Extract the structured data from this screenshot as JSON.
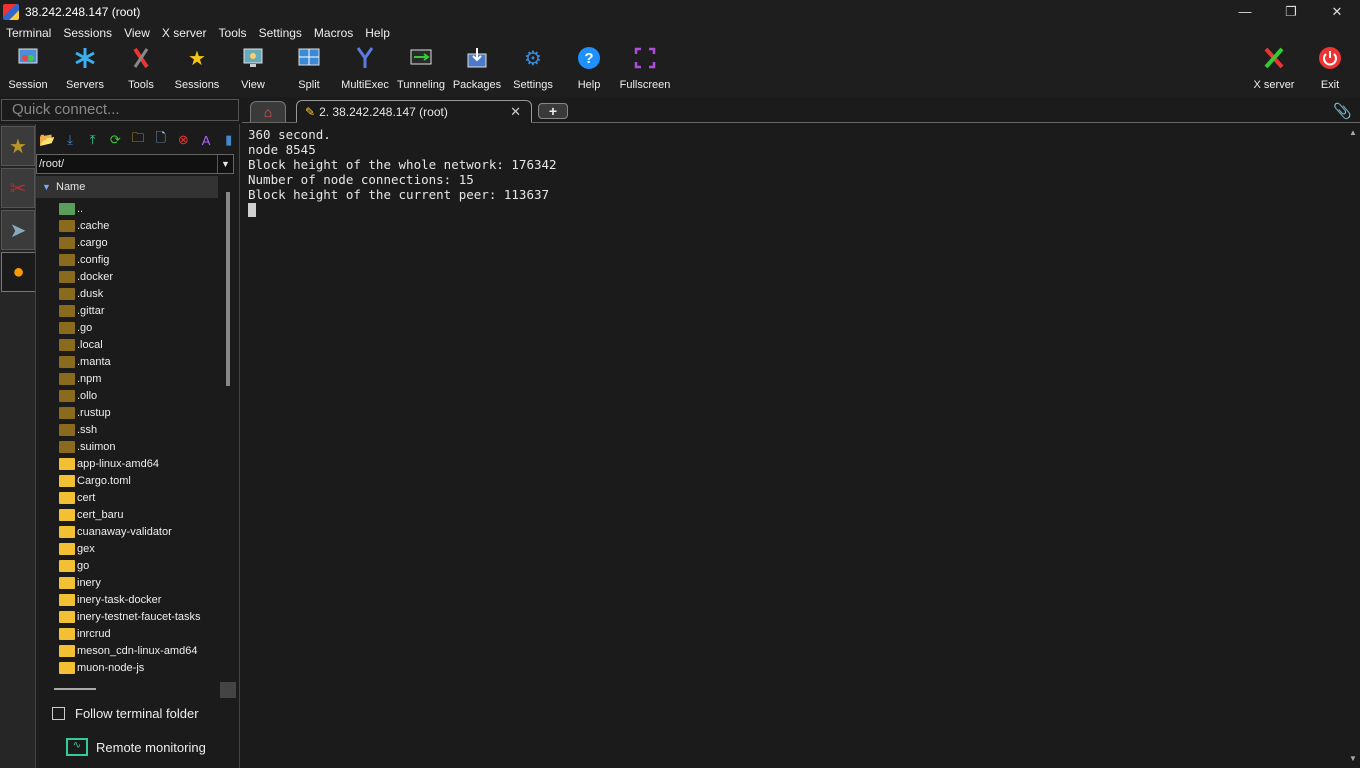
{
  "window": {
    "title": "38.242.248.147 (root)"
  },
  "menu": [
    "Terminal",
    "Sessions",
    "View",
    "X server",
    "Tools",
    "Settings",
    "Macros",
    "Help"
  ],
  "toolbar": {
    "session": "Session",
    "servers": "Servers",
    "tools": "Tools",
    "sessions": "Sessions",
    "view": "View",
    "split": "Split",
    "multiexec": "MultiExec",
    "tunneling": "Tunneling",
    "packages": "Packages",
    "settings": "Settings",
    "help": "Help",
    "fullscreen": "Fullscreen",
    "xserver": "X server",
    "exit": "Exit"
  },
  "quick_connect": {
    "placeholder": "Quick connect..."
  },
  "tabs": {
    "session_tab": "2. 38.242.248.147 (root)"
  },
  "sftp": {
    "path": "/root/",
    "column_name": "Name",
    "files": [
      {
        "name": "..",
        "kind": "up"
      },
      {
        "name": ".cache",
        "kind": "hidden"
      },
      {
        "name": ".cargo",
        "kind": "hidden"
      },
      {
        "name": ".config",
        "kind": "hidden"
      },
      {
        "name": ".docker",
        "kind": "hidden"
      },
      {
        "name": ".dusk",
        "kind": "hidden"
      },
      {
        "name": ".gittar",
        "kind": "hidden"
      },
      {
        "name": ".go",
        "kind": "hidden"
      },
      {
        "name": ".local",
        "kind": "hidden"
      },
      {
        "name": ".manta",
        "kind": "hidden"
      },
      {
        "name": ".npm",
        "kind": "hidden"
      },
      {
        "name": ".ollo",
        "kind": "hidden"
      },
      {
        "name": ".rustup",
        "kind": "hidden"
      },
      {
        "name": ".ssh",
        "kind": "hidden"
      },
      {
        "name": ".suimon",
        "kind": "hidden"
      },
      {
        "name": "app-linux-amd64",
        "kind": "normal"
      },
      {
        "name": "Cargo.toml",
        "kind": "normal"
      },
      {
        "name": "cert",
        "kind": "normal"
      },
      {
        "name": "cert_baru",
        "kind": "normal"
      },
      {
        "name": "cuanaway-validator",
        "kind": "normal"
      },
      {
        "name": "gex",
        "kind": "normal"
      },
      {
        "name": "go",
        "kind": "normal"
      },
      {
        "name": "inery",
        "kind": "normal"
      },
      {
        "name": "inery-task-docker",
        "kind": "normal"
      },
      {
        "name": "inery-testnet-faucet-tasks",
        "kind": "normal"
      },
      {
        "name": "inrcrud",
        "kind": "normal"
      },
      {
        "name": "meson_cdn-linux-amd64",
        "kind": "normal"
      },
      {
        "name": "muon-node-js",
        "kind": "normal"
      }
    ],
    "follow_label": "Follow terminal folder",
    "remote_label": "Remote monitoring"
  },
  "terminal": {
    "lines": [
      "360 second.",
      "node 8545",
      "Block height of the whole network: 176342",
      "Number of node connections: 15",
      "Block height of the current peer: 113637"
    ]
  }
}
